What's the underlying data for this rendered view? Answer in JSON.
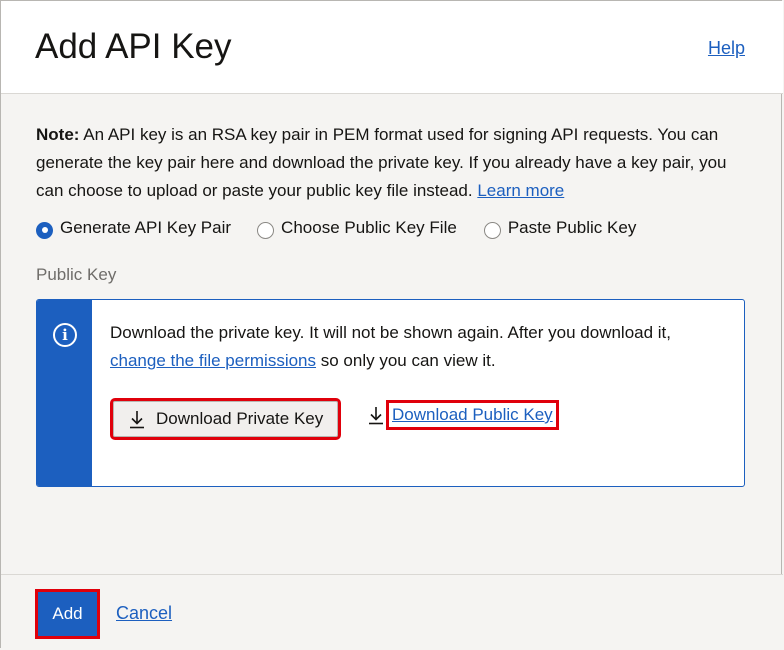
{
  "dialog": {
    "title": "Add API Key",
    "help_link": "Help"
  },
  "note": {
    "label": "Note:",
    "text": " An API key is an RSA key pair in PEM format used for signing API requests. You can generate the key pair here and download the private key. If you already have a key pair, you can choose to upload or paste your public key file instead. ",
    "learn_more": "Learn more"
  },
  "options": {
    "selected": "generate",
    "items": [
      {
        "id": "generate",
        "label": "Generate API Key Pair"
      },
      {
        "id": "choose",
        "label": "Choose Public Key File"
      },
      {
        "id": "paste",
        "label": "Paste Public Key"
      }
    ]
  },
  "public_key": {
    "label": "Public Key",
    "info_text_before": "Download the private key. It will not be shown again. After you download it, ",
    "info_link": "change the file permissions",
    "info_text_after": " so only you can view it.",
    "download_private_label": "Download Private Key",
    "download_public_label": "Download Public Key"
  },
  "footer": {
    "add_label": "Add",
    "cancel_label": "Cancel"
  },
  "colors": {
    "accent": "#1c5fbf",
    "highlight": "#e0000b",
    "background": "#f5f4f2"
  },
  "icons": {
    "info": "info-icon",
    "download": "download-icon"
  }
}
